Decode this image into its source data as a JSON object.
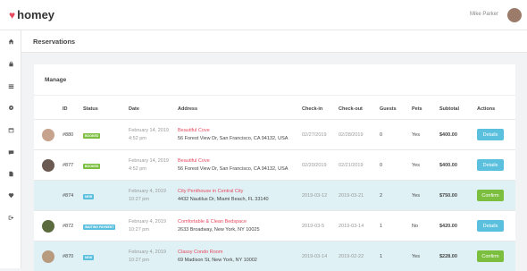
{
  "brand": {
    "name": "homey",
    "heart_color": "#e84a5f"
  },
  "user": {
    "name": "Mike Parker"
  },
  "sidebar": {
    "icons": [
      "home-icon",
      "lock-icon",
      "list-icon",
      "gear-icon",
      "calendar-icon",
      "chat-icon",
      "document-icon",
      "heart-icon",
      "logout-icon"
    ]
  },
  "page": {
    "title": "Reservations"
  },
  "panel": {
    "title": "Manage"
  },
  "table": {
    "headers": {
      "id": "ID",
      "status": "Status",
      "date": "Date",
      "address": "Address",
      "checkin": "Check-in",
      "checkout": "Check-out",
      "guests": "Guests",
      "pets": "Pets",
      "subtotal": "Subtotal",
      "actions": "Actions"
    },
    "rows": [
      {
        "id": "#880",
        "status": "BOOKED",
        "date_line1": "February 14, 2019",
        "date_line2": "4:52 pm",
        "addr_title": "Beautiful Cove",
        "addr_line": "56 Forest View Dr, San Francisco, CA 94132, USA",
        "checkin": "02/27/2019",
        "checkout": "02/28/2019",
        "guests": "0",
        "pets": "Yes",
        "subtotal": "$400.00",
        "action": "Details"
      },
      {
        "id": "#877",
        "status": "BOOKED",
        "date_line1": "February 14, 2019",
        "date_line2": "4:52 pm",
        "addr_title": "Beautiful Cove",
        "addr_line": "56 Forest View Dr, San Francisco, CA 94132, USA",
        "checkin": "02/20/2019",
        "checkout": "02/21/2019",
        "guests": "0",
        "pets": "Yes",
        "subtotal": "$400.00",
        "action": "Details"
      },
      {
        "id": "#874",
        "status": "NEW",
        "date_line1": "February 4, 2019",
        "date_line2": "10:27 pm",
        "addr_title": "City Penthouse in Central City",
        "addr_line": "4432 Nautilus Dr, Miami Beach, FL 33140",
        "checkin": "2019-03-12",
        "checkout": "2019-03-21",
        "guests": "2",
        "pets": "Yes",
        "subtotal": "$750.00",
        "action": "Confirm"
      },
      {
        "id": "#872",
        "status": "WAITING PAYMENT",
        "date_line1": "February 4, 2019",
        "date_line2": "10:27 pm",
        "addr_title": "Comfortable & Clean Bedspace",
        "addr_line": "2633 Broadway, New York, NY 10025",
        "checkin": "2019-03-5",
        "checkout": "2019-03-14",
        "guests": "1",
        "pets": "No",
        "subtotal": "$420.00",
        "action": "Details"
      },
      {
        "id": "#870",
        "status": "NEW",
        "date_line1": "February 4, 2019",
        "date_line2": "10:27 pm",
        "addr_title": "Classy Condo Room",
        "addr_line": "69 Madison St, New York, NY 10002",
        "checkin": "2019-03-14",
        "checkout": "2019-02-22",
        "guests": "1",
        "pets": "Yes",
        "subtotal": "$228.00",
        "action": "Confirm"
      }
    ]
  }
}
